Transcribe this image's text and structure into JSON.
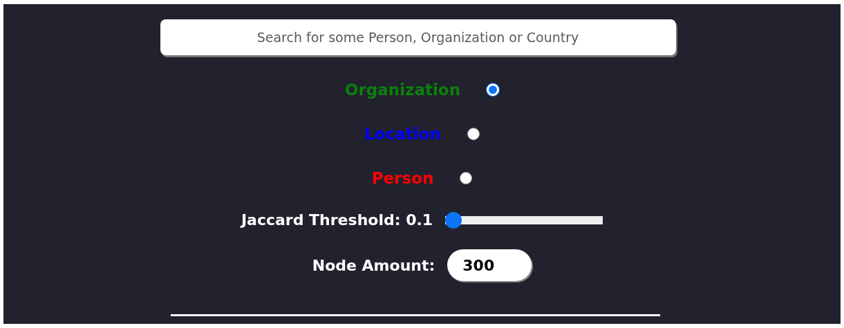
{
  "search": {
    "placeholder": "Search for some Person, Organization or Country"
  },
  "entity_types": [
    {
      "label": "Organization",
      "color": "#0b800b",
      "selected": true
    },
    {
      "label": "Location",
      "color": "#0000ff",
      "selected": false
    },
    {
      "label": "Person",
      "color": "#ff0000",
      "selected": false
    }
  ],
  "jaccard_threshold": {
    "label": "Jaccard Threshold: 0.1",
    "level": 0
  },
  "node_amount": {
    "label": "Node Amount:",
    "value": "300"
  }
}
